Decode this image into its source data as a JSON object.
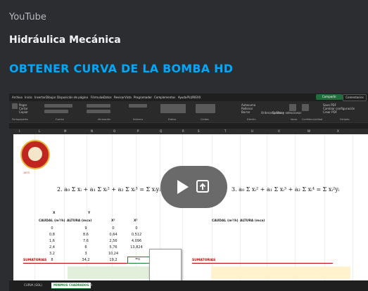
{
  "embed": {
    "provider": "YouTube",
    "author": "Hidráulica Mecánica",
    "title": "OBTENER CURVA DE LA BOMBA HD",
    "title_color": "#00a8fc"
  },
  "excel": {
    "ribbon_tabs": [
      "Archivo",
      "Inicio",
      "Insertar",
      "Dibujar",
      "Disposición de página",
      "Fórmulas",
      "Datos",
      "Revisar",
      "Vista",
      "Programador",
      "Complementos",
      "Ayuda",
      "PLURIEXX"
    ],
    "share_label": "Compartir",
    "comments_label": "Comentarios",
    "ribbon_groups": [
      "Portapapeles",
      "Fuente",
      "Alineación",
      "Número",
      "Estilos",
      "Celdas",
      "Edición",
      "Ideas",
      "Confidencialidad",
      "Dictado"
    ],
    "ribbon_tools": [
      "Pegar",
      "Cortar",
      "Copiar",
      "Autosuma",
      "Rellenar",
      "Borrar",
      "Ordenar y filtrar",
      "Buscar y seleccionar",
      "Save PDF",
      "Cambiar configuración",
      "Crear PDF"
    ],
    "column_headers": [
      "I",
      "L",
      "M",
      "N",
      "O",
      "P",
      "Q",
      "R",
      "S",
      "T",
      "U",
      "V",
      "W",
      "X"
    ],
    "logo_year": "1973",
    "formula_2": "2. a₀ Σ xᵢ + a₁ Σ xᵢ² + a₂ Σ xᵢ³ = Σ xᵢyᵢ",
    "formula_3": "3. a₀ Σ xᵢ² + a₁ Σ xᵢ³ + a₂ Σ xᵢ⁴ = Σ xᵢ²yᵢ",
    "left_table": {
      "top_headers": [
        "X",
        "Y"
      ],
      "headers": [
        "CAUDAL (m³/h)",
        "ALTURA (mca)",
        "X²",
        "X³"
      ],
      "rows": [
        [
          "0",
          "9",
          "0",
          "0"
        ],
        [
          "0,8",
          "8,6",
          "0,64",
          "0,512"
        ],
        [
          "1,6",
          "7,6",
          "2,56",
          "4,096"
        ],
        [
          "2,4",
          "6",
          "5,76",
          "13,824"
        ],
        [
          "3,2",
          "3",
          "10,24",
          ""
        ]
      ],
      "sum_label": "SUMATORIAS",
      "sum_values": [
        "8",
        "34,2",
        "19,2",
        "=s"
      ]
    },
    "right_table": {
      "headers": [
        "CAUDAL (m³/h)",
        "ALTURA (mca)"
      ],
      "sum_label": "SUMATORIAS"
    },
    "sheet_tabs": [
      "CURVA (SOL)",
      "MINIMOS CUADRADOS"
    ],
    "active_sheet": "MINIMOS CUADRADOS"
  },
  "colors": {
    "background": "#2b2d31",
    "link": "#00a8fc",
    "excel_green": "#1a7f37",
    "sum_red": "#c00000"
  },
  "icons": [
    "play-icon",
    "open-external-icon"
  ]
}
